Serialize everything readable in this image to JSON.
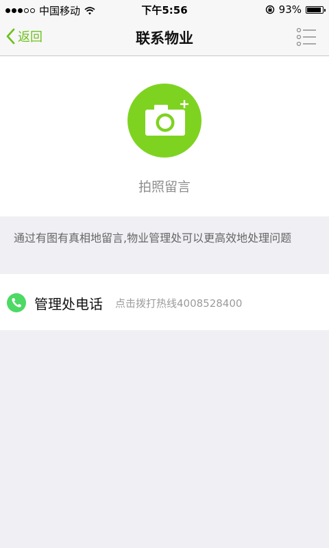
{
  "status_bar": {
    "carrier": "中国移动",
    "time": "下午5:56",
    "battery_percent": "93%",
    "battery_level": 0.93
  },
  "nav": {
    "back_label": "返回",
    "title": "联系物业"
  },
  "photo": {
    "label": "拍照留言"
  },
  "info": {
    "text": "通过有图有真相地留言,物业管理处可以更高效地处理问题"
  },
  "phone": {
    "title": "管理处电话",
    "hint": "点击拨打热线4008528400"
  },
  "colors": {
    "accent": "#7ed321",
    "nav_accent": "#6dc11f",
    "phone_green": "#4cd964"
  }
}
